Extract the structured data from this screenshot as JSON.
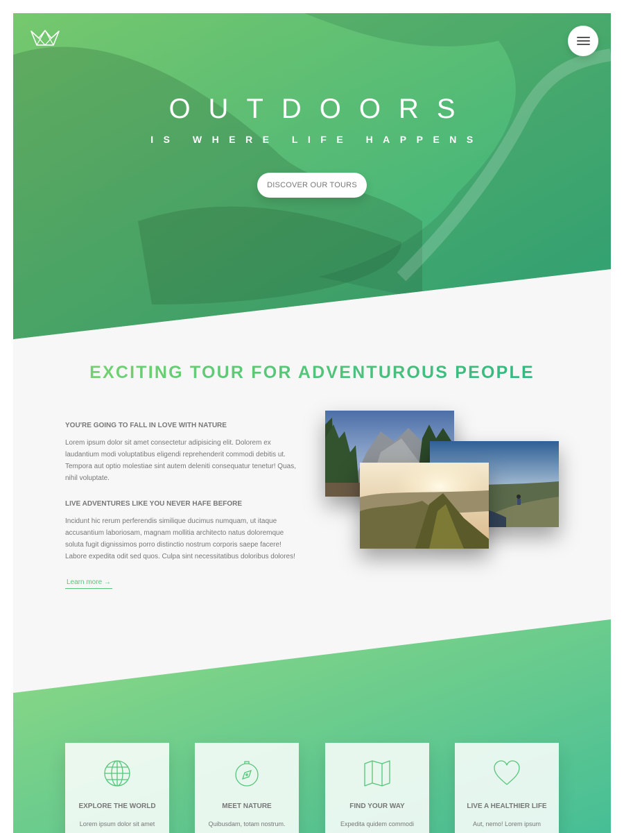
{
  "hero": {
    "title": "OUTDOORS",
    "subtitle": "IS WHERE LIFE HAPPENS",
    "cta_label": "DISCOVER OUR TOURS"
  },
  "about": {
    "heading": "EXCITING TOUR FOR ADVENTUROUS PEOPLE",
    "block1_title": "YOU'RE GOING TO FALL IN LOVE WITH NATURE",
    "block1_text": "Lorem ipsum dolor sit amet consectetur adipisicing elit. Dolorem ex laudantium modi voluptatibus eligendi reprehenderit commodi debitis ut. Tempora aut optio molestiae sint autem deleniti consequatur tenetur! Quas, nihil voluptate.",
    "block2_title": "LIVE ADVENTURES LIKE YOU NEVER HAFE BEFORE",
    "block2_text": "Incidunt hic rerum perferendis similique ducimus numquam, ut itaque accusantium laboriosam, magnam mollitia architecto natus doloremque soluta fugit dignissimos porro distinctio nostrum corporis saepe facere! Labore expedita odit sed quos. Culpa sint necessitatibus doloribus dolores!",
    "learn_more": "Learn more →"
  },
  "features": [
    {
      "icon": "globe-icon",
      "title": "EXPLORE THE WORLD",
      "text": "Lorem ipsum dolor sit amet"
    },
    {
      "icon": "compass-icon",
      "title": "MEET NATURE",
      "text": "Quibusdam, totam nostrum."
    },
    {
      "icon": "map-icon",
      "title": "FIND YOUR WAY",
      "text": "Expedita quidem commodi"
    },
    {
      "icon": "heart-icon",
      "title": "LIVE A HEALTHIER LIFE",
      "text": "Aut, nemo! Lorem ipsum"
    }
  ],
  "colors": {
    "primary_light": "#7ed56f",
    "primary_dark": "#28b485",
    "text": "#777777",
    "background": "#f7f7f7"
  }
}
